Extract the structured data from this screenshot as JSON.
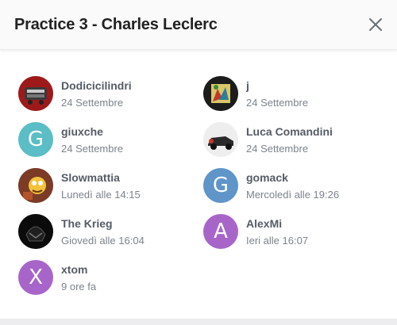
{
  "modal": {
    "title": "Practice 3 - Charles Leclerc",
    "close_icon": "close-icon"
  },
  "users": [
    {
      "name": "Dodicicilindri",
      "time": "24 Settembre",
      "avatar": {
        "type": "image",
        "icon": "car-engine-photo"
      }
    },
    {
      "name": "j",
      "time": "24 Settembre",
      "avatar": {
        "type": "image",
        "icon": "art-photo"
      }
    },
    {
      "name": "giuxche",
      "time": "24 Settembre",
      "avatar": {
        "type": "letter",
        "letter": "G",
        "color": "#5bbdc6"
      }
    },
    {
      "name": "Luca Comandini",
      "time": "24 Settembre",
      "avatar": {
        "type": "image",
        "icon": "car-photo"
      }
    },
    {
      "name": "Slowmattia",
      "time": "Lunedì alle 14:15",
      "avatar": {
        "type": "image",
        "icon": "cartoon-photo"
      }
    },
    {
      "name": "gomack",
      "time": "Mercoledì alle 19:26",
      "avatar": {
        "type": "letter",
        "letter": "G",
        "color": "#5f95c8"
      }
    },
    {
      "name": "The Krieg",
      "time": "Giovedì alle 16:04",
      "avatar": {
        "type": "image",
        "icon": "dark-helmet-photo"
      }
    },
    {
      "name": "AlexMi",
      "time": "Ieri alle 16:07",
      "avatar": {
        "type": "letter",
        "letter": "A",
        "color": "#a865c9"
      }
    },
    {
      "name": "xtom",
      "time": "9 ore fa",
      "avatar": {
        "type": "letter",
        "letter": "X",
        "color": "#a865c9"
      }
    }
  ]
}
